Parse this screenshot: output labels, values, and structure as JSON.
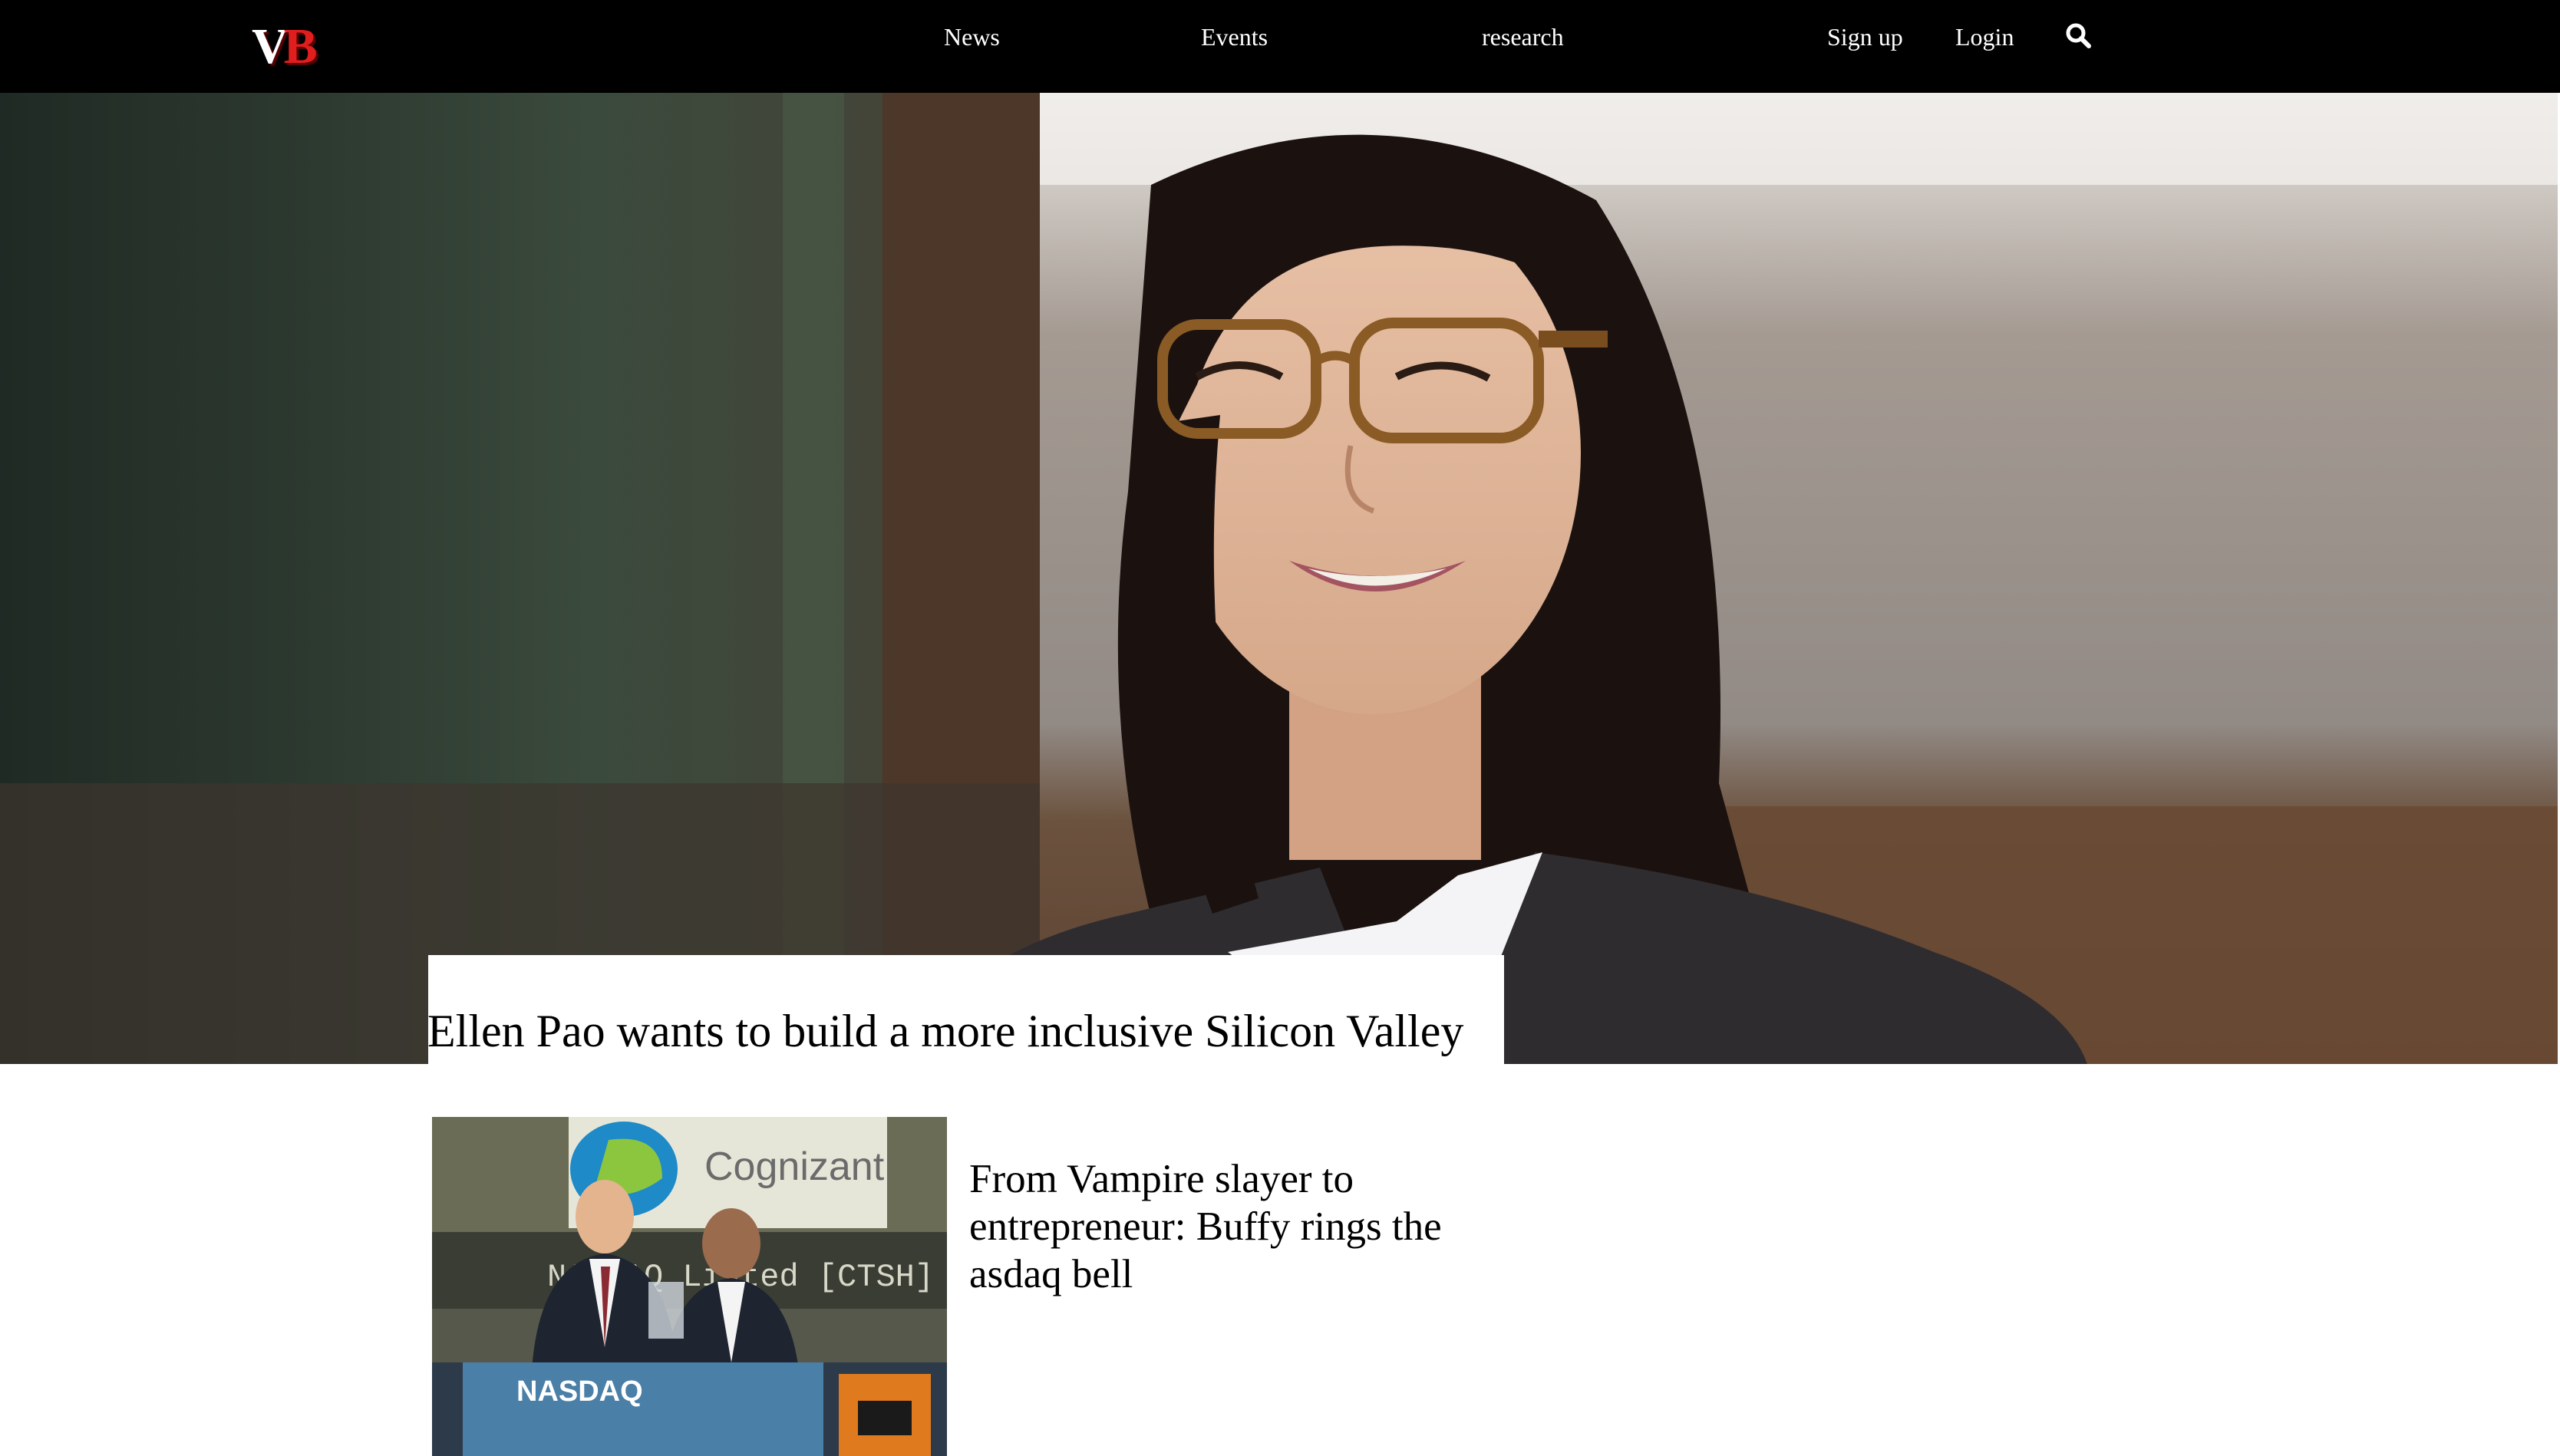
{
  "brand": {
    "logo_v": "V",
    "logo_b": "B"
  },
  "nav": {
    "news": "News",
    "events": "Events",
    "research": "research",
    "signup": "Sign up",
    "login": "Login"
  },
  "hero": {
    "headline": "Ellen Pao wants to build a more inclusive Silicon Valley"
  },
  "articles": [
    {
      "title": "From Vampire slayer to entrepreneur: Buffy rings the asdaq bell",
      "thumb_text": {
        "company": "Cognizant",
        "ticker": "NASDAQ Listed [CTSH]",
        "exchange": "NASDAQ"
      }
    }
  ],
  "colors": {
    "nav_bg": "#000000",
    "accent_red": "#e01e1e",
    "text": "#000000"
  },
  "icons": {
    "search": "search-icon"
  }
}
